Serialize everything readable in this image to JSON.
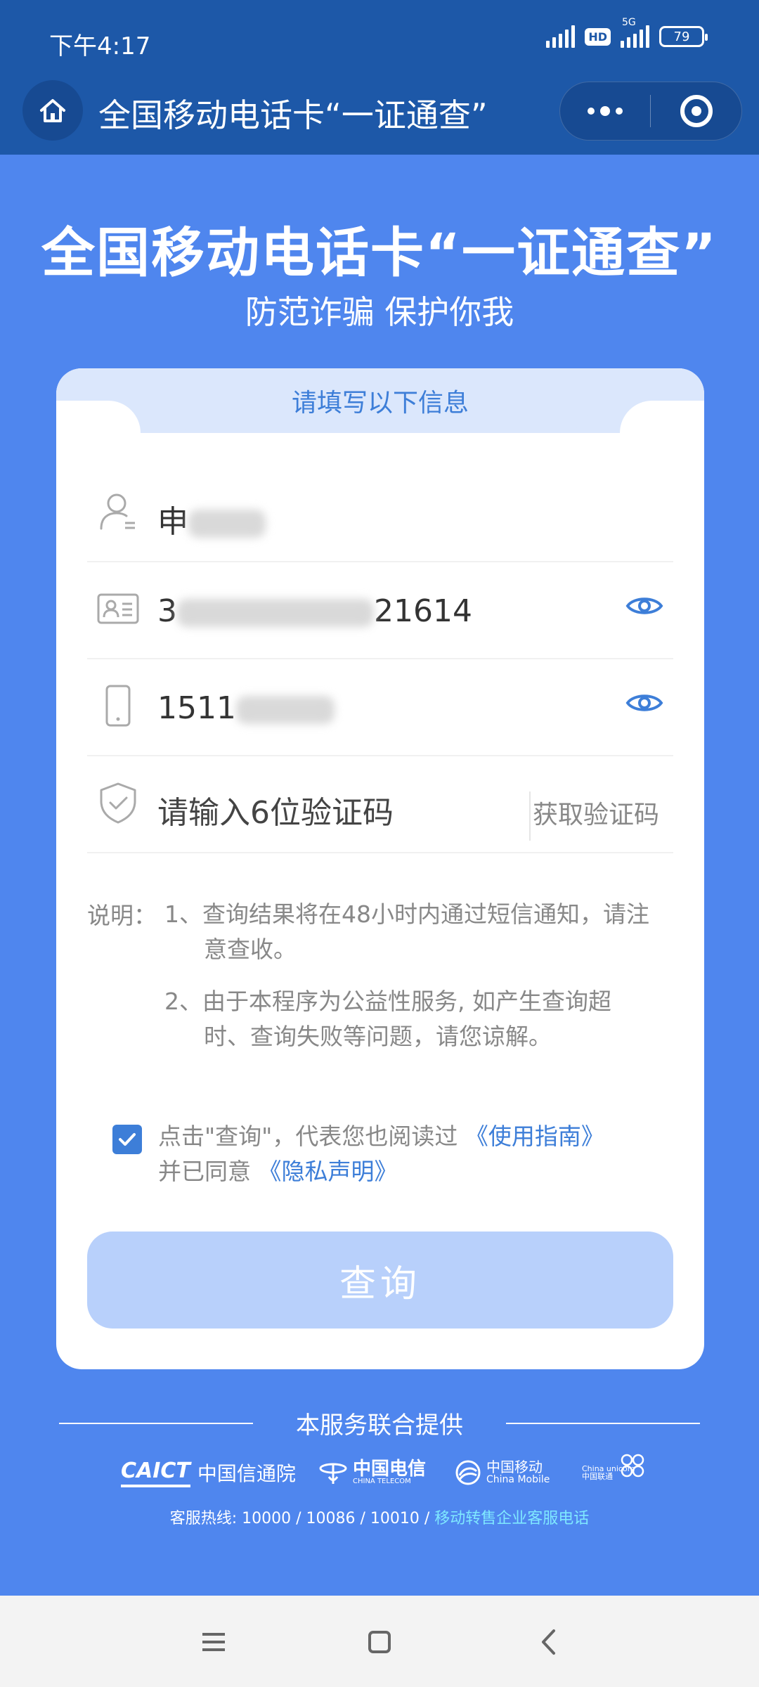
{
  "status_bar": {
    "time": "下午4:17",
    "battery": "79",
    "hd": "HD",
    "network": "5G"
  },
  "nav": {
    "title": "全国移动电话卡“一证通查”"
  },
  "hero": {
    "title": "全国移动电话卡“一证通查”",
    "subtitle": "防范诈骗 保护你我"
  },
  "form": {
    "header": "请填写以下信息",
    "name_prefix": "申",
    "id_prefix": "3",
    "id_suffix": "21614",
    "phone_prefix": "1511",
    "code_placeholder": "请输入6位验证码",
    "get_code_label": "获取验证码"
  },
  "notes": {
    "label": "说明：",
    "item1_line1": "1、查询结果将在48小时内通过短信通知，请注",
    "item1_line2": "意查收。",
    "item2_line1": "2、由于本程序为公益性服务, 如产生查询超",
    "item2_line2": "时、查询失败等问题，请您谅解。"
  },
  "agreement": {
    "line1_text": "点击\"查询\"，代表您也阅读过 ",
    "guide_link": "《使用指南》",
    "line2_text": "并已同意 ",
    "privacy_link": "《隐私声明》",
    "checked": true
  },
  "query_button": "查询",
  "footer": {
    "provided_by": "本服务联合提供",
    "logos": {
      "caict_mark": "CAICT",
      "caict_name": "中国信通院",
      "telecom_cn": "中国电信",
      "telecom_en": "CHINA TELECOM",
      "mobile_cn": "中国移动",
      "mobile_en": "China Mobile",
      "unicom_en": "China unicom",
      "unicom_cn": "中国联通"
    },
    "hotline_text": "客服热线: 10000 / 10086 / 10010 / ",
    "hotline_link": "移动转售企业客服电话"
  },
  "colors": {
    "header_bg": "#1d58a8",
    "page_bg": "#4f86ee",
    "accent": "#3d7ed8",
    "button_disabled": "#b8d0fb"
  }
}
